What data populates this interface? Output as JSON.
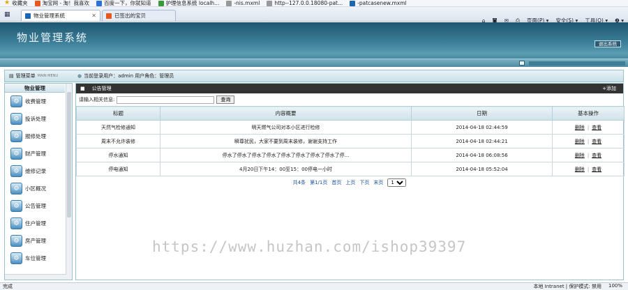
{
  "favorites_bar": {
    "label": "收藏夹",
    "items": [
      "淘宝网 - 淘！我喜欢",
      "百度一下，你就知道",
      "护理信息系统 localh...",
      "-nis.mxml",
      "http--127.0.0.18080-pat...",
      "-patcasenew.mxml"
    ]
  },
  "tabs": [
    {
      "label": "物业管理系统",
      "active": true
    },
    {
      "label": "已签出的宝贝",
      "active": false
    }
  ],
  "ie_toolbar": {
    "page": "页面(P) ▾",
    "safety": "安全(S) ▾",
    "tools": "工具(O) ▾",
    "help": "❷ ▾"
  },
  "header": {
    "title": "物业管理系统",
    "logout": "退出系统"
  },
  "infobar": {
    "menu_title": "管理菜单",
    "menu_sub": "MAIN MENU",
    "user_text": "当前登录用户：admin  用户角色：管理员"
  },
  "sidebar": {
    "title": "物业管理",
    "items": [
      "收费管理",
      "投诉处理",
      "报修处理",
      "财产管理",
      "维修记录",
      "小区概况",
      "公告管理",
      "住户管理",
      "房产管理",
      "车位管理"
    ]
  },
  "panel": {
    "title": "公告管理",
    "add": "+添加"
  },
  "search": {
    "label": "请输入相关信息:",
    "value": "",
    "button": "查询"
  },
  "table": {
    "headers": [
      "标题",
      "内容概要",
      "日期",
      "基本操作"
    ],
    "rows": [
      {
        "title": "天然气检修通知",
        "content": "明天燃气公司对本小区进行检修",
        "date": "2014-04-18 02:44:59",
        "delete": "删除",
        "view": "查看"
      },
      {
        "title": "周末不允许装修",
        "content": "瞬尊扰民，大家不要到周末装修，谢谢支持工作",
        "date": "2014-04-18 02:44:21",
        "delete": "删除",
        "view": "查看"
      },
      {
        "title": "停水通知",
        "content": "停水了停水了停水了停水了停水了停水了停水了停水了停...",
        "date": "2014-04-18 06:08:56",
        "delete": "删除",
        "view": "查看"
      },
      {
        "title": "停电通知",
        "content": "4月20日下午14：00至15：00停电一小时",
        "date": "2014-04-18 05:52:04",
        "delete": "删除",
        "view": "查看"
      }
    ]
  },
  "pager": {
    "total": "共4条",
    "page_info": "第1/1页",
    "first": "首页",
    "prev": "上页",
    "next": "下页",
    "last": "末页",
    "selected": "1"
  },
  "watermark": "https://www.huzhan.com/ishop39397",
  "statusbar": {
    "left": "完成",
    "zone": "本地 Intranet | 保护模式: 禁用",
    "zoom": "100%"
  },
  "colors": {
    "header": "#3d7f98",
    "panel_head": "#333333",
    "accent": "#9cc0cf"
  }
}
